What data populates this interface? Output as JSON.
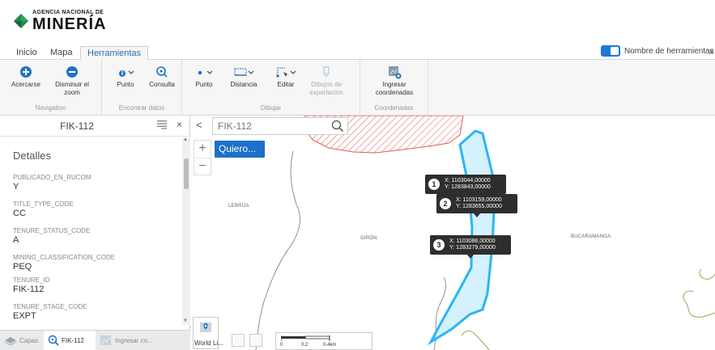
{
  "brand": {
    "line1": "AGENCIA NACIONAL DE",
    "line2": "MINERÍA",
    "green": "#1e8b4c"
  },
  "tabs": [
    {
      "label": "Inicio"
    },
    {
      "label": "Mapa"
    },
    {
      "label": "Herramientas",
      "active": true
    }
  ],
  "tool_names_toggle": {
    "label": "Nombre de herramientas",
    "on": true,
    "close": "x"
  },
  "ribbon": {
    "navigation": {
      "label": "Navigation",
      "zoom_in": "Acercarse",
      "zoom_out_1": "Disminuir el",
      "zoom_out_2": "zoom"
    },
    "find": {
      "label": "Encontrar datos",
      "point": "Punto",
      "query": "Consulta"
    },
    "draw": {
      "label": "Dibujar",
      "point": "Punto",
      "distance": "Distancia",
      "edit": "Editar",
      "export_1": "Dibujos de",
      "export_2": "exportación"
    },
    "coords": {
      "label": "Coordenadas",
      "enter_1": "Ingresar",
      "enter_2": "coordenadas"
    }
  },
  "panel": {
    "title": "FIK-112",
    "close": "×",
    "details_title": "Detalles",
    "fields": [
      {
        "key": "PUBLICADO_EN_RUCOM",
        "value": "Y"
      },
      {
        "key": "TITLE_TYPE_CODE",
        "value": "CC"
      },
      {
        "key": "TENURE_STATUS_CODE",
        "value": "A"
      },
      {
        "key": "MINING_CLASSIFICATION_CODE",
        "value": "PEQ"
      },
      {
        "key": "TENURE_ID",
        "value": "FIK-112"
      },
      {
        "key": "TENURE_STAGE_CODE",
        "value": "EXPT"
      }
    ],
    "bottom_tabs": [
      {
        "label": "Capas"
      },
      {
        "label": "FIK-112",
        "active": true
      },
      {
        "label": "Ingresar co..."
      }
    ]
  },
  "map": {
    "collapse": "<",
    "search_value": "FIK-112",
    "zoom_in": "+",
    "zoom_out": "−",
    "quiero_label": "Quiero...",
    "places": [
      {
        "name": "LEBRIJA"
      },
      {
        "name": "GIRÓN"
      },
      {
        "name": "BUCARAMANGA"
      }
    ],
    "points": [
      {
        "n": "1",
        "x": "X: 1103044,00000",
        "y": "Y: 1283843,00000"
      },
      {
        "n": "2",
        "x": "X: 1103159,00000",
        "y": "Y: 1283655,00000"
      },
      {
        "n": "3",
        "x": "X: 1103088,00000",
        "y": "Y: 1283279,00000"
      }
    ],
    "basemap_label": "World Li...",
    "scale": {
      "zero": "0",
      "mid": "0.2",
      "end": "0.4km"
    },
    "colors": {
      "polygon": "#29b6f6",
      "hatch": "#e25c4f",
      "contour": "#8ab04a"
    }
  }
}
